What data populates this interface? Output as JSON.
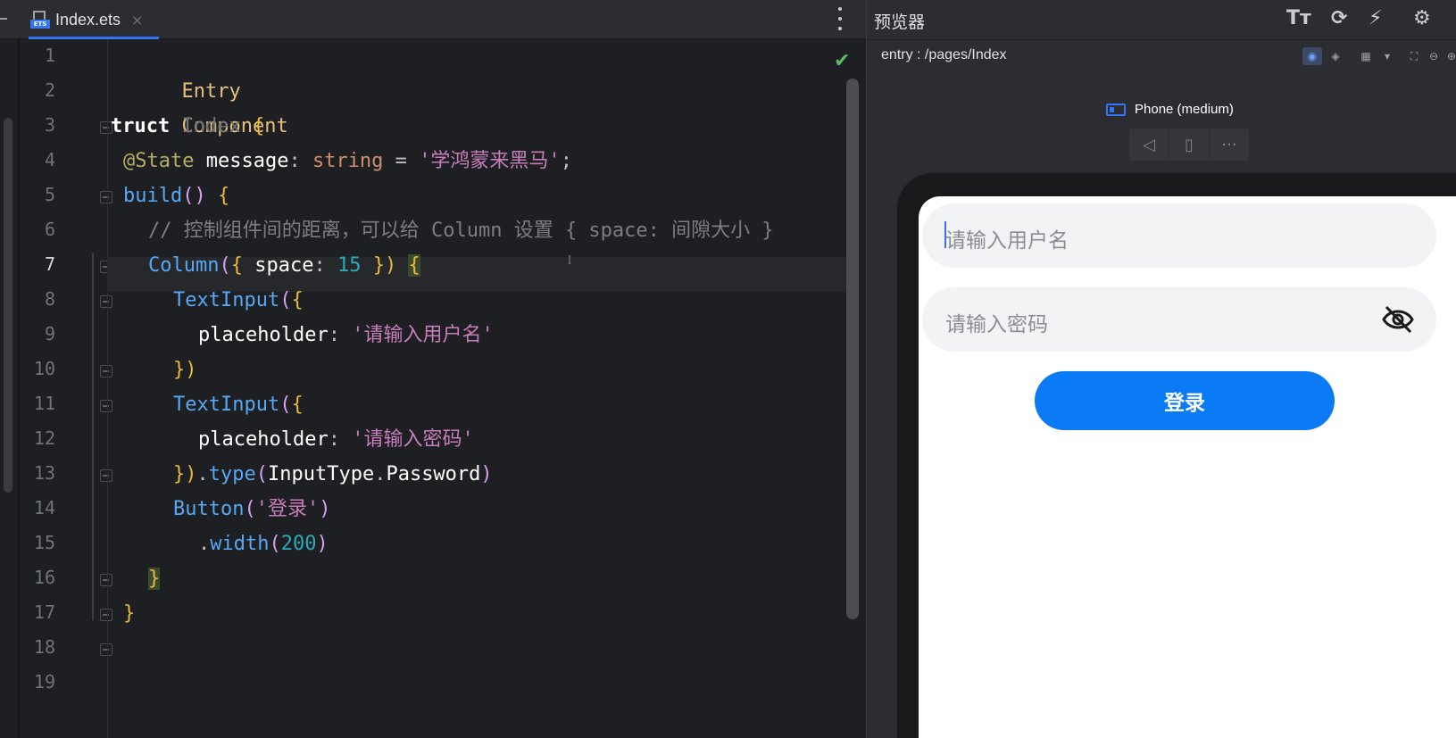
{
  "editor": {
    "tab_label": "Index.ets",
    "file_badge": "ETS",
    "line_numbers": [
      "1",
      "2",
      "3",
      "4",
      "5",
      "6",
      "7",
      "8",
      "9",
      "10",
      "11",
      "12",
      "13",
      "14",
      "15",
      "16",
      "17",
      "18",
      "19"
    ],
    "code": {
      "l1": [
        "Entry"
      ],
      "l2": [
        "Component"
      ],
      "l3": [
        "truct",
        " Index ",
        "{"
      ],
      "l4": [
        "@State",
        " message",
        ": ",
        "string",
        " = ",
        "'学鸿蒙来黑马'",
        ";"
      ],
      "l5": [
        "build",
        "() ",
        "{"
      ],
      "l6": [
        "// 控制组件间的距离，可以给 Column 设置 { space: 间隙大小 }"
      ],
      "l7": [
        "Column",
        "(",
        "{ ",
        "space",
        ": ",
        "15",
        " })",
        " ",
        "{"
      ],
      "l8": [
        "TextInput",
        "(",
        "{"
      ],
      "l9": [
        "placeholder",
        ": ",
        "'请输入用户名'"
      ],
      "l10": [
        "})"
      ],
      "l11": [
        "TextInput",
        "(",
        "{"
      ],
      "l12": [
        "placeholder",
        ": ",
        "'请输入密码'"
      ],
      "l13": [
        "})",
        ".",
        "type",
        "(",
        "InputType",
        ".",
        "Password",
        ")"
      ],
      "l14": [
        "Button",
        "(",
        "'登录'",
        ")"
      ],
      "l15": [
        ".",
        "width",
        "(",
        "200",
        ")"
      ],
      "l16": [
        "}"
      ],
      "l17": [
        "}"
      ]
    }
  },
  "previewer": {
    "title": "预览器",
    "path": "entry : /pages/Index",
    "device": "Phone (medium)",
    "icons": {
      "font": "Tт",
      "refresh": "⟳",
      "plug": "⚡",
      "settings": "⚙"
    },
    "app": {
      "username_placeholder": "请输入用户名",
      "password_placeholder": "请输入密码",
      "login_label": "登录"
    }
  },
  "colors": {
    "accent": "#3574f0",
    "button": "#0a7af5",
    "check": "#5fb865"
  }
}
